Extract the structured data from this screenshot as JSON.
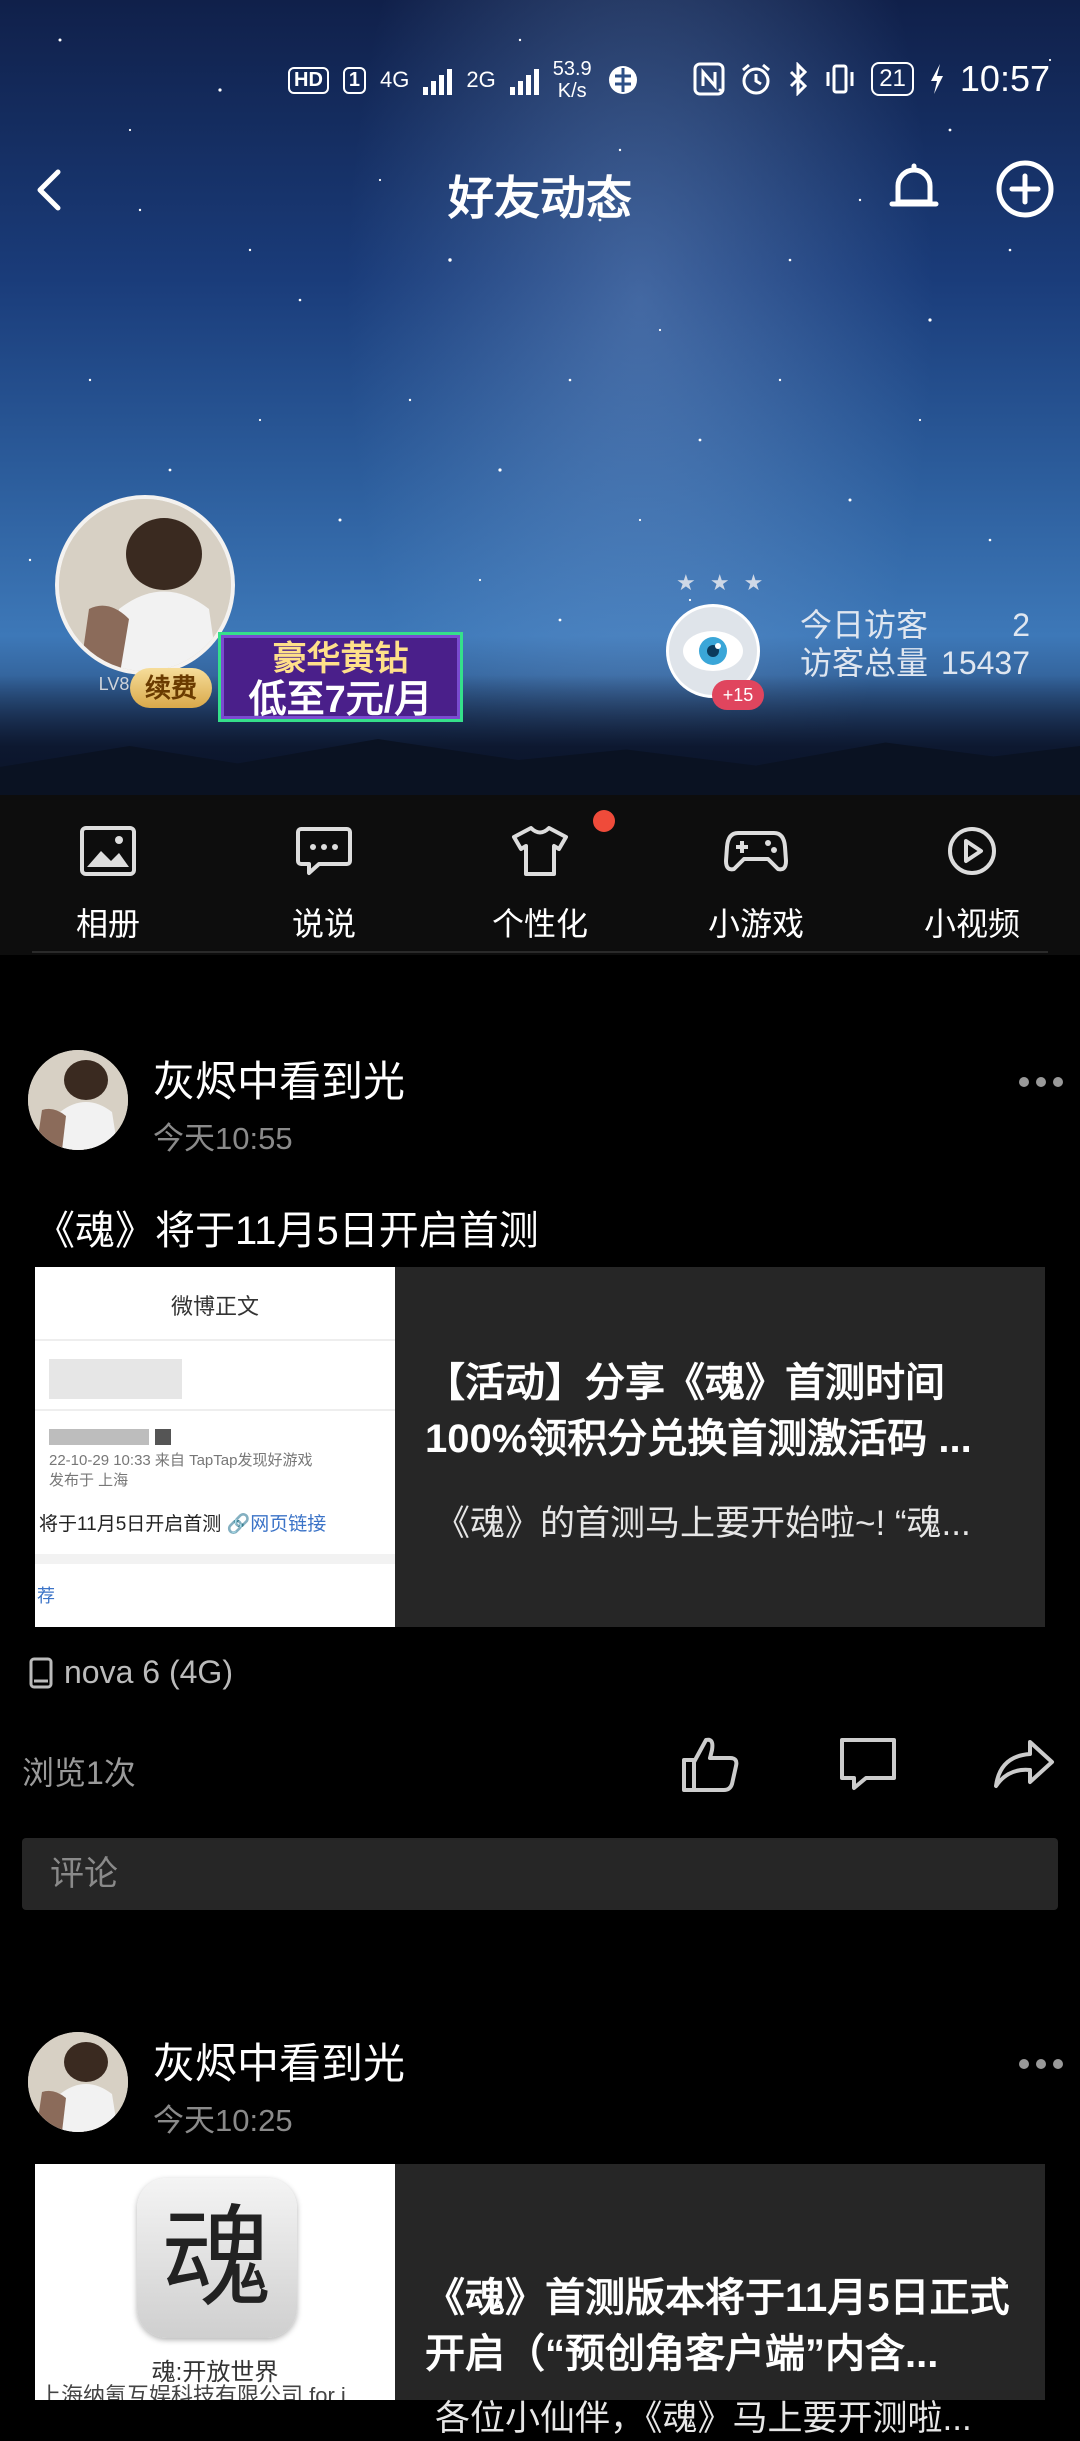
{
  "status_bar": {
    "hd_label": "HD",
    "sim1": "1",
    "net1": "4G",
    "net2": "2G",
    "speed_value": "53.9",
    "speed_unit": "K/s",
    "battery": "21",
    "time": "10:57"
  },
  "nav": {
    "title": "好友动态"
  },
  "profile": {
    "level": "LV8",
    "renew_label": "续费",
    "vip_line1": "豪华黄钻",
    "vip_line2": "低至7元/月",
    "eye_badge": "+15",
    "today_visitors_label": "今日访客",
    "today_visitors_value": "2",
    "total_visitors_label": "访客总量",
    "total_visitors_value": "15437"
  },
  "shortcuts": [
    {
      "label": "相册",
      "icon": "photo-album-icon"
    },
    {
      "label": "说说",
      "icon": "chat-bubble-icon"
    },
    {
      "label": "个性化",
      "icon": "tshirt-icon"
    },
    {
      "label": "小游戏",
      "icon": "gamepad-icon"
    },
    {
      "label": "小视频",
      "icon": "play-circle-icon"
    }
  ],
  "posts": [
    {
      "author": "灰烬中看到光",
      "time": "今天10:55",
      "text": "《魂》将于11月5日开启首测",
      "card": {
        "thumb_header": "微博正文",
        "thumb_meta": "22-10-29 10:33  来自 TapTap发现好游戏",
        "thumb_location": "发布于 上海",
        "thumb_body": "将于11月5日开启首测",
        "thumb_link": "🔗网页链接",
        "thumb_footer": "荐",
        "title": "【活动】分享《魂》首测时间100%领积分兑换首测激活码 ...",
        "desc": "《魂》的首测马上要开始啦~! “魂..."
      },
      "device": "nova 6 (4G)",
      "views": "浏览1次",
      "comment_placeholder": "评论"
    },
    {
      "author": "灰烬中看到光",
      "time": "今天10:25",
      "card": {
        "app_icon_glyph": "魂",
        "app_name": "魂:开放世界",
        "app_company": "上海纳氪互娱科技有限公司 for i",
        "title": "《魂》首测版本将于11月5日正式开启（“预创角客户端”内含...",
        "desc": "各位小仙伴，《魂》马上要开测啦..."
      }
    }
  ],
  "colors": {
    "background": "#000000",
    "card": "#262626",
    "shortcut_bar": "#0d0d0d",
    "red_dot": "#ef4b3a",
    "muted_text": "#8a8a8a"
  }
}
